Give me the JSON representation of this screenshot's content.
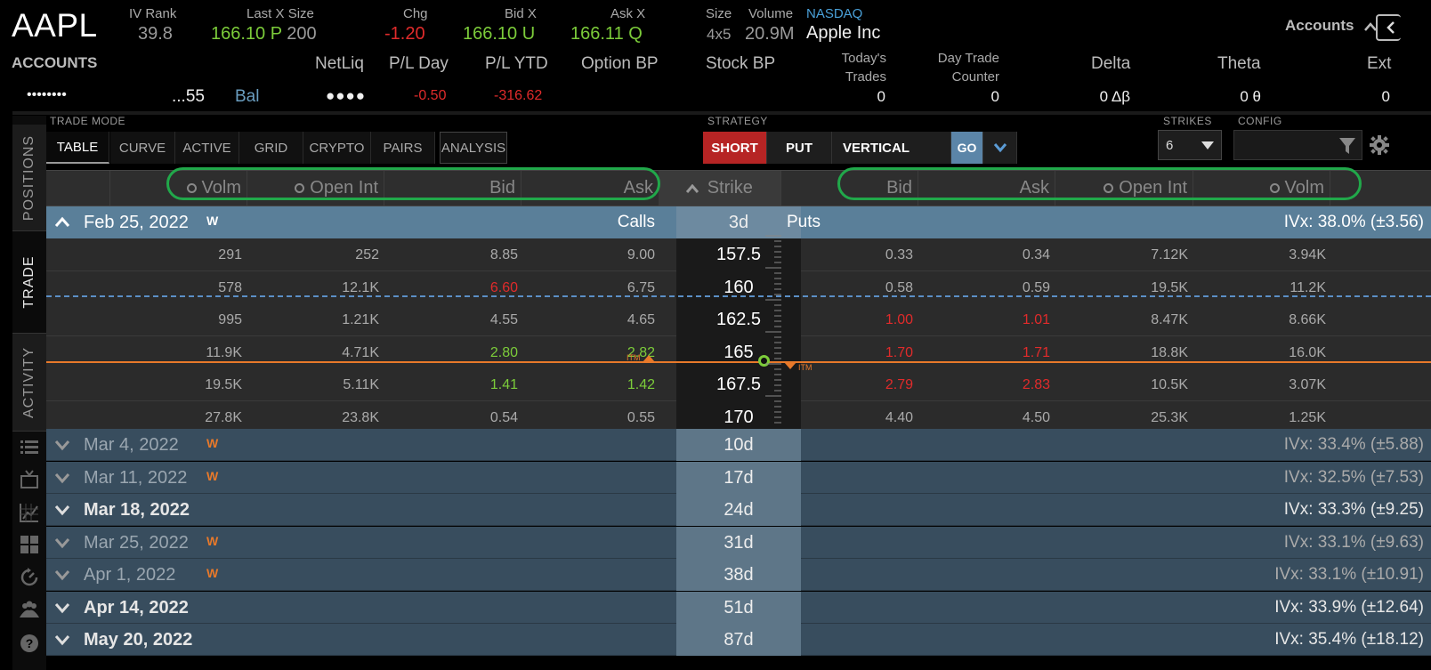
{
  "quote": {
    "symbol": "AAPL",
    "iv_rank_label": "IV Rank",
    "iv_rank": "39.8",
    "last_label": "Last X Size",
    "last_price": "166.10",
    "last_exch": "P",
    "last_size": "200",
    "chg_label": "Chg",
    "chg": "-1.20",
    "bid_label": "Bid X",
    "bid": "166.10 U",
    "ask_label": "Ask X",
    "ask": "166.11 Q",
    "size_label": "Size",
    "size": "4x5",
    "volume_label": "Volume",
    "volume": "20.9M",
    "exchange": "NASDAQ",
    "company": "Apple Inc",
    "accounts_button": "Accounts"
  },
  "account": {
    "title": "ACCOUNTS",
    "masked_id": "••••••••",
    "suffix": "...55",
    "bal_label": "Bal",
    "netliq_label": "NetLiq",
    "netliq": "●●●●",
    "pl_day_label": "P/L Day",
    "pl_day": "-0.50",
    "pl_ytd_label": "P/L YTD",
    "pl_ytd": "-316.62",
    "option_bp_label": "Option BP",
    "stock_bp_label": "Stock BP",
    "todays_trades_label_1": "Today's",
    "todays_trades_label_2": "Trades",
    "todays_trades": "0",
    "dtc_label_1": "Day Trade",
    "dtc_label_2": "Counter",
    "dtc": "0",
    "delta_label": "Delta",
    "delta": "0 Δβ",
    "theta_label": "Theta",
    "theta": "0 θ",
    "ext_label": "Ext",
    "ext": "0"
  },
  "sidebar": {
    "tabs": [
      "POSITIONS",
      "TRADE",
      "ACTIVITY"
    ]
  },
  "toolbar": {
    "trade_mode_label": "TRADE MODE",
    "tabs": [
      "TABLE",
      "CURVE",
      "ACTIVE",
      "GRID",
      "CRYPTO",
      "PAIRS",
      "ANALYSIS"
    ],
    "strategy_label": "STRATEGY",
    "short": "SHORT",
    "put": "PUT",
    "vertical": "VERTICAL",
    "go": "GO",
    "strikes_label": "STRIKES",
    "strikes_value": "6",
    "config_label": "CONFIG"
  },
  "columns": {
    "calls": [
      "Volm",
      "Open Int",
      "Bid",
      "Ask"
    ],
    "strike": "Strike",
    "puts": [
      "Bid",
      "Ask",
      "Open Int",
      "Volm"
    ]
  },
  "expanded": {
    "date": "Feb 25, 2022",
    "badge": "W",
    "calls_label": "Calls",
    "dte": "3d",
    "puts_label": "Puts",
    "ivx": "IVx: 38.0% (±3.56)",
    "itm": "ITM",
    "rows": [
      {
        "c_volm": "291",
        "c_oi": "252",
        "c_bid": "8.85",
        "c_ask": "9.00",
        "strike": "157.5",
        "p_bid": "0.33",
        "p_ask": "0.34",
        "p_oi": "7.12K",
        "p_volm": "3.94K"
      },
      {
        "c_volm": "578",
        "c_oi": "12.1K",
        "c_bid": "6.60",
        "c_ask": "6.75",
        "strike": "160",
        "p_bid": "0.58",
        "p_ask": "0.59",
        "p_oi": "19.5K",
        "p_volm": "11.2K"
      },
      {
        "c_volm": "995",
        "c_oi": "1.21K",
        "c_bid": "4.55",
        "c_ask": "4.65",
        "strike": "162.5",
        "p_bid": "1.00",
        "p_ask": "1.01",
        "p_oi": "8.47K",
        "p_volm": "8.66K"
      },
      {
        "c_volm": "11.9K",
        "c_oi": "4.71K",
        "c_bid": "2.80",
        "c_ask": "2.82",
        "strike": "165",
        "p_bid": "1.70",
        "p_ask": "1.71",
        "p_oi": "18.8K",
        "p_volm": "16.0K"
      },
      {
        "c_volm": "19.5K",
        "c_oi": "5.11K",
        "c_bid": "1.41",
        "c_ask": "1.42",
        "strike": "167.5",
        "p_bid": "2.79",
        "p_ask": "2.83",
        "p_oi": "10.5K",
        "p_volm": "3.07K"
      },
      {
        "c_volm": "27.8K",
        "c_oi": "23.8K",
        "c_bid": "0.54",
        "c_ask": "0.55",
        "strike": "170",
        "p_bid": "4.40",
        "p_ask": "4.50",
        "p_oi": "25.3K",
        "p_volm": "1.25K"
      }
    ]
  },
  "expirations": [
    {
      "date": "Mar 4, 2022",
      "badge": "W",
      "dte": "10d",
      "ivx": "IVx: 33.4% (±5.88)"
    },
    {
      "date": "Mar 11, 2022",
      "badge": "W",
      "dte": "17d",
      "ivx": "IVx: 32.5% (±7.53)"
    },
    {
      "date": "Mar 18, 2022",
      "badge": "",
      "dte": "24d",
      "ivx": "IVx: 33.3% (±9.25)"
    },
    {
      "date": "Mar 25, 2022",
      "badge": "W",
      "dte": "31d",
      "ivx": "IVx: 33.1% (±9.63)"
    },
    {
      "date": "Apr 1, 2022",
      "badge": "W",
      "dte": "38d",
      "ivx": "IVx: 33.1% (±10.91)"
    },
    {
      "date": "Apr 14, 2022",
      "badge": "",
      "dte": "51d",
      "ivx": "IVx: 33.9% (±12.64)"
    },
    {
      "date": "May 20, 2022",
      "badge": "",
      "dte": "87d",
      "ivx": "IVx: 35.4% (±18.12)"
    }
  ],
  "colors": {
    "green": "#7ccc3a",
    "red": "#e02b2b",
    "itm_orange": "#e8792a",
    "highlight_circle": "#21a84a"
  }
}
